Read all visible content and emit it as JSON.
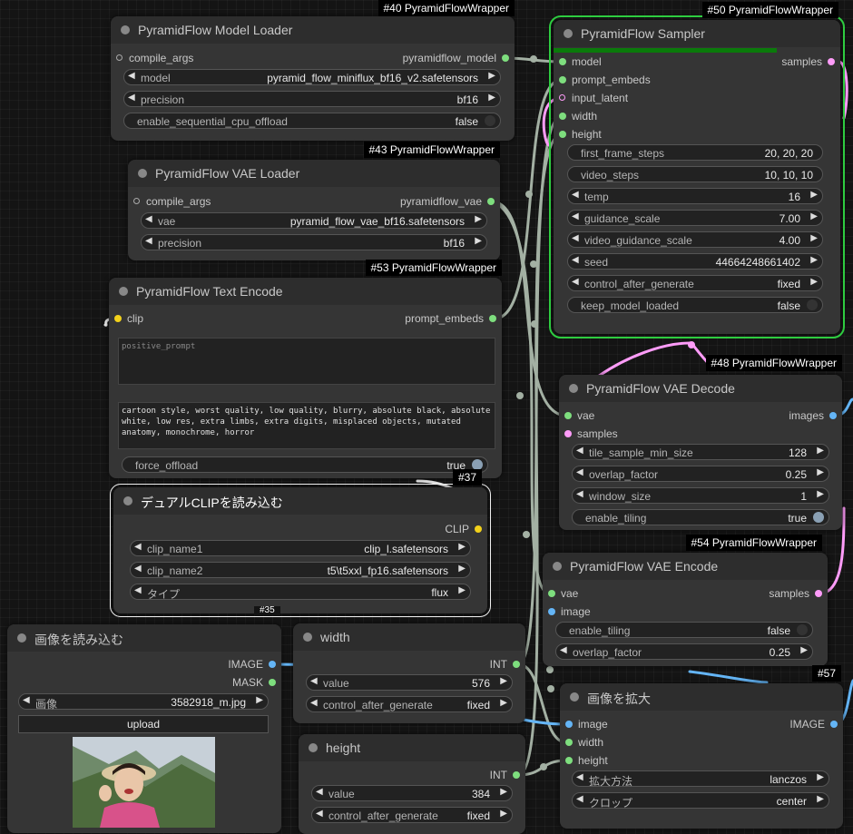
{
  "colors": {
    "model": "#7ede7e",
    "clip": "#f2d11b",
    "image": "#64b5f6",
    "latent": "#ff9cf9",
    "int": "#7ede7e",
    "wire": "#a3b0a3",
    "selected": "#2ecc40",
    "progress": "#0a7a0a"
  },
  "badges": {
    "n40": "#40 PyramidFlowWrapper",
    "n50": "#50 PyramidFlowWrapper",
    "n43": "#43 PyramidFlowWrapper",
    "n53": "#53 PyramidFlowWrapper",
    "n48": "#48 PyramidFlowWrapper",
    "n37": "#37",
    "n54": "#54 PyramidFlowWrapper",
    "n57": "#57",
    "n35": "#35"
  },
  "model_loader": {
    "title": "PyramidFlow Model Loader",
    "in_compile": "compile_args",
    "out": "pyramidflow_model",
    "model_label": "model",
    "model_value": "pyramid_flow_miniflux_bf16_v2.safetensors",
    "precision_label": "precision",
    "precision_value": "bf16",
    "offload_label": "enable_sequential_cpu_offload",
    "offload_value": "false"
  },
  "vae_loader": {
    "title": "PyramidFlow VAE Loader",
    "in_compile": "compile_args",
    "out": "pyramidflow_vae",
    "vae_label": "vae",
    "vae_value": "pyramid_flow_vae_bf16.safetensors",
    "precision_label": "precision",
    "precision_value": "bf16"
  },
  "text_encode": {
    "title": "PyramidFlow Text Encode",
    "in_clip": "clip",
    "out": "prompt_embeds",
    "positive_placeholder": "positive_prompt",
    "negative_text": "cartoon style, worst quality, low quality, blurry, absolute black, absolute white, low res, extra limbs, extra digits, misplaced objects, mutated anatomy, monochrome, horror",
    "force_label": "force_offload",
    "force_value": "true"
  },
  "dual_clip": {
    "title": "デュアルCLIPを読み込む",
    "out": "CLIP",
    "c1_label": "clip_name1",
    "c1_value": "clip_l.safetensors",
    "c2_label": "clip_name2",
    "c2_value": "t5\\t5xxl_fp16.safetensors",
    "type_label": "タイプ",
    "type_value": "flux"
  },
  "load_image": {
    "title": "画像を読み込む",
    "out_image": "IMAGE",
    "out_mask": "MASK",
    "image_label": "画像",
    "image_value": "3582918_m.jpg",
    "upload": "upload"
  },
  "width_node": {
    "title": "width",
    "out": "INT",
    "value_label": "value",
    "value": "576",
    "cag_label": "control_after_generate",
    "cag_value": "fixed"
  },
  "height_node": {
    "title": "height",
    "out": "INT",
    "value_label": "value",
    "value": "384",
    "cag_label": "control_after_generate",
    "cag_value": "fixed"
  },
  "sampler": {
    "title": "PyramidFlow Sampler",
    "progress": 0.78,
    "in_model": "model",
    "in_prompt": "prompt_embeds",
    "in_latent": "input_latent",
    "in_width": "width",
    "in_height": "height",
    "out": "samples",
    "ffs_label": "first_frame_steps",
    "ffs_value": "20, 20, 20",
    "vs_label": "video_steps",
    "vs_value": "10, 10, 10",
    "temp_label": "temp",
    "temp_value": "16",
    "gs_label": "guidance_scale",
    "gs_value": "7.00",
    "vgs_label": "video_guidance_scale",
    "vgs_value": "4.00",
    "seed_label": "seed",
    "seed_value": "44664248661402",
    "cag_label": "control_after_generate",
    "cag_value": "fixed",
    "keep_label": "keep_model_loaded",
    "keep_value": "false"
  },
  "vae_decode": {
    "title": "PyramidFlow VAE Decode",
    "in_vae": "vae",
    "in_samples": "samples",
    "out": "images",
    "tile_label": "tile_sample_min_size",
    "tile_value": "128",
    "overlap_label": "overlap_factor",
    "overlap_value": "0.25",
    "window_label": "window_size",
    "window_value": "1",
    "tiling_label": "enable_tiling",
    "tiling_value": "true"
  },
  "vae_encode": {
    "title": "PyramidFlow VAE Encode",
    "in_vae": "vae",
    "in_image": "image",
    "out": "samples",
    "tiling_label": "enable_tiling",
    "tiling_value": "false",
    "overlap_label": "overlap_factor",
    "overlap_value": "0.25"
  },
  "upscale": {
    "title": "画像を拡大",
    "in_image": "image",
    "in_width": "width",
    "in_height": "height",
    "out": "IMAGE",
    "method_label": "拡大方法",
    "method_value": "lanczos",
    "crop_label": "クロップ",
    "crop_value": "center"
  }
}
